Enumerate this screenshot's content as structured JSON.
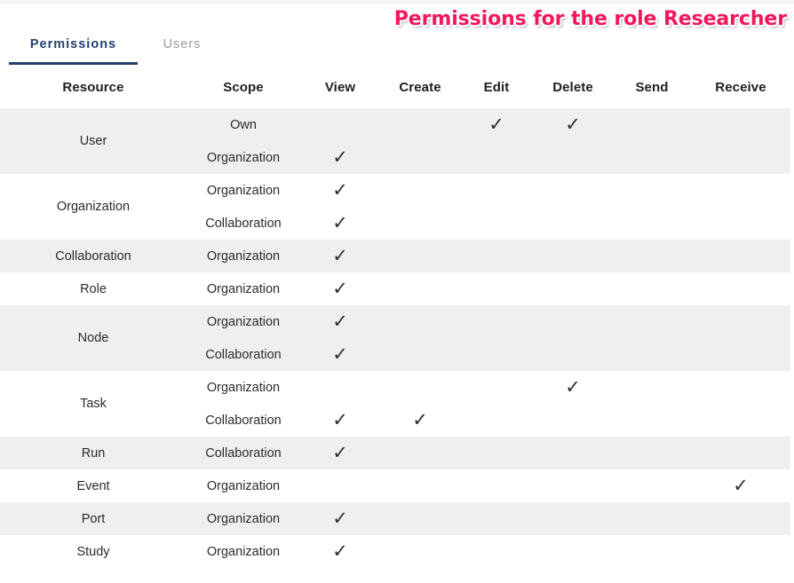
{
  "overlay": {
    "title": "Permissions for the role Researcher",
    "color": "#f4175c"
  },
  "tabs": [
    {
      "label": "Permissions",
      "active": true
    },
    {
      "label": "Users",
      "active": false
    }
  ],
  "table": {
    "columns": [
      "Resource",
      "Scope",
      "View",
      "Create",
      "Edit",
      "Delete",
      "Send",
      "Receive"
    ],
    "check_glyph": "✓",
    "rows": [
      {
        "resource": "User",
        "scope": "Own",
        "view": "",
        "create": "",
        "edit": "✓",
        "delete": "✓",
        "send": "",
        "receive": ""
      },
      {
        "resource": "",
        "scope": "Organization",
        "view": "✓",
        "create": "",
        "edit": "",
        "delete": "",
        "send": "",
        "receive": ""
      },
      {
        "resource": "Organization",
        "scope": "Organization",
        "view": "✓",
        "create": "",
        "edit": "",
        "delete": "",
        "send": "",
        "receive": ""
      },
      {
        "resource": "",
        "scope": "Collaboration",
        "view": "✓",
        "create": "",
        "edit": "",
        "delete": "",
        "send": "",
        "receive": ""
      },
      {
        "resource": "Collaboration",
        "scope": "Organization",
        "view": "✓",
        "create": "",
        "edit": "",
        "delete": "",
        "send": "",
        "receive": ""
      },
      {
        "resource": "Role",
        "scope": "Organization",
        "view": "✓",
        "create": "",
        "edit": "",
        "delete": "",
        "send": "",
        "receive": ""
      },
      {
        "resource": "Node",
        "scope": "Organization",
        "view": "✓",
        "create": "",
        "edit": "",
        "delete": "",
        "send": "",
        "receive": ""
      },
      {
        "resource": "",
        "scope": "Collaboration",
        "view": "✓",
        "create": "",
        "edit": "",
        "delete": "",
        "send": "",
        "receive": ""
      },
      {
        "resource": "Task",
        "scope": "Organization",
        "view": "",
        "create": "",
        "edit": "",
        "delete": "✓",
        "send": "",
        "receive": ""
      },
      {
        "resource": "",
        "scope": "Collaboration",
        "view": "✓",
        "create": "✓",
        "edit": "",
        "delete": "",
        "send": "",
        "receive": ""
      },
      {
        "resource": "Run",
        "scope": "Collaboration",
        "view": "✓",
        "create": "",
        "edit": "",
        "delete": "",
        "send": "",
        "receive": ""
      },
      {
        "resource": "Event",
        "scope": "Organization",
        "view": "",
        "create": "",
        "edit": "",
        "delete": "",
        "send": "",
        "receive": "✓"
      },
      {
        "resource": "Port",
        "scope": "Organization",
        "view": "✓",
        "create": "",
        "edit": "",
        "delete": "",
        "send": "",
        "receive": ""
      },
      {
        "resource": "Study",
        "scope": "Organization",
        "view": "✓",
        "create": "",
        "edit": "",
        "delete": "",
        "send": "",
        "receive": ""
      }
    ],
    "groups": [
      {
        "resource": "User",
        "rowspan": 2,
        "stripe": "gray"
      },
      {
        "resource": "Organization",
        "rowspan": 2,
        "stripe": "white"
      },
      {
        "resource": "Collaboration",
        "rowspan": 1,
        "stripe": "gray"
      },
      {
        "resource": "Role",
        "rowspan": 1,
        "stripe": "white"
      },
      {
        "resource": "Node",
        "rowspan": 2,
        "stripe": "gray"
      },
      {
        "resource": "Task",
        "rowspan": 2,
        "stripe": "white"
      },
      {
        "resource": "Run",
        "rowspan": 1,
        "stripe": "gray"
      },
      {
        "resource": "Event",
        "rowspan": 1,
        "stripe": "white"
      },
      {
        "resource": "Port",
        "rowspan": 1,
        "stripe": "gray"
      },
      {
        "resource": "Study",
        "rowspan": 1,
        "stripe": "white"
      }
    ]
  }
}
